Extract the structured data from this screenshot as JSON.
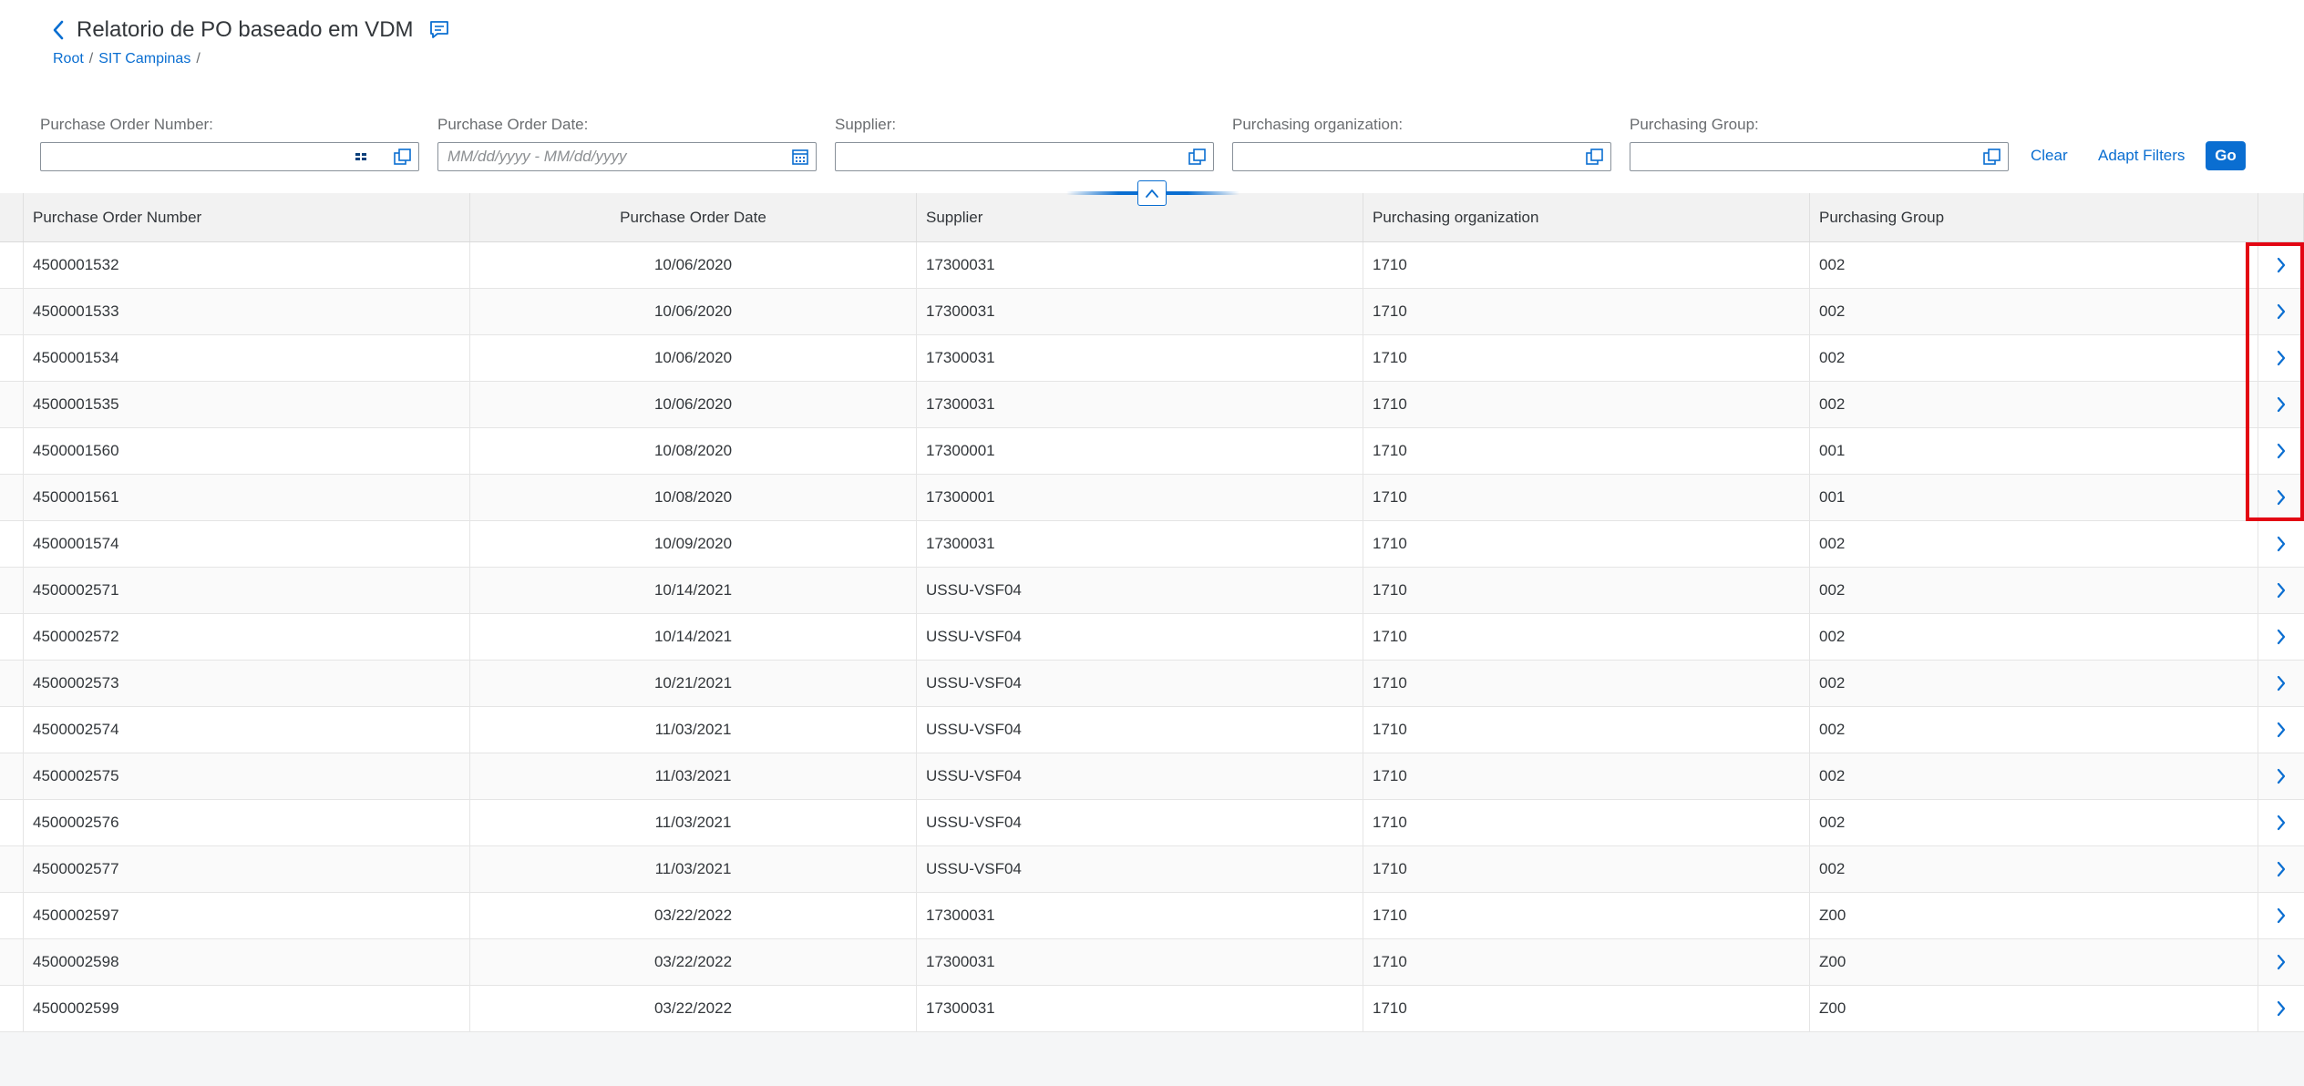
{
  "header": {
    "title": "Relatorio de PO baseado em VDM",
    "breadcrumb": [
      "Root",
      "SIT Campinas"
    ]
  },
  "filters": [
    {
      "label": "Purchase Order Number:",
      "value": "",
      "placeholder": ""
    },
    {
      "label": "Purchase Order Date:",
      "value": "",
      "placeholder": "MM/dd/yyyy - MM/dd/yyyy"
    },
    {
      "label": "Supplier:",
      "value": "",
      "placeholder": ""
    },
    {
      "label": "Purchasing organization:",
      "value": "",
      "placeholder": ""
    },
    {
      "label": "Purchasing Group:",
      "value": "",
      "placeholder": ""
    }
  ],
  "filterbar": {
    "clear_label": "Clear",
    "adapt_label": "Adapt Filters",
    "go_label": "Go"
  },
  "table": {
    "columns": [
      "Purchase Order Number",
      "Purchase Order Date",
      "Supplier",
      "Purchasing organization",
      "Purchasing Group"
    ],
    "rows": [
      [
        "4500001532",
        "10/06/2020",
        "17300031",
        "1710",
        "002"
      ],
      [
        "4500001533",
        "10/06/2020",
        "17300031",
        "1710",
        "002"
      ],
      [
        "4500001534",
        "10/06/2020",
        "17300031",
        "1710",
        "002"
      ],
      [
        "4500001535",
        "10/06/2020",
        "17300031",
        "1710",
        "002"
      ],
      [
        "4500001560",
        "10/08/2020",
        "17300001",
        "1710",
        "001"
      ],
      [
        "4500001561",
        "10/08/2020",
        "17300001",
        "1710",
        "001"
      ],
      [
        "4500001574",
        "10/09/2020",
        "17300031",
        "1710",
        "002"
      ],
      [
        "4500002571",
        "10/14/2021",
        "USSU-VSF04",
        "1710",
        "002"
      ],
      [
        "4500002572",
        "10/14/2021",
        "USSU-VSF04",
        "1710",
        "002"
      ],
      [
        "4500002573",
        "10/21/2021",
        "USSU-VSF04",
        "1710",
        "002"
      ],
      [
        "4500002574",
        "11/03/2021",
        "USSU-VSF04",
        "1710",
        "002"
      ],
      [
        "4500002575",
        "11/03/2021",
        "USSU-VSF04",
        "1710",
        "002"
      ],
      [
        "4500002576",
        "11/03/2021",
        "USSU-VSF04",
        "1710",
        "002"
      ],
      [
        "4500002577",
        "11/03/2021",
        "USSU-VSF04",
        "1710",
        "002"
      ],
      [
        "4500002597",
        "03/22/2022",
        "17300031",
        "1710",
        "Z00"
      ],
      [
        "4500002598",
        "03/22/2022",
        "17300031",
        "1710",
        "Z00"
      ],
      [
        "4500002599",
        "03/22/2022",
        "17300031",
        "1710",
        "Z00"
      ]
    ]
  },
  "icons": {
    "back": "chevron-left-icon",
    "title_action": "feedback-icon",
    "value_help": "value-help-icon",
    "calendar": "calendar-icon",
    "token": "multi-input-icon",
    "collapse": "chevron-up-icon",
    "row_nav": "chevron-right-icon"
  },
  "colors": {
    "accent": "#0a6ed1",
    "highlight": "#e30613",
    "text": "#32363a",
    "label": "#6a6d70"
  }
}
